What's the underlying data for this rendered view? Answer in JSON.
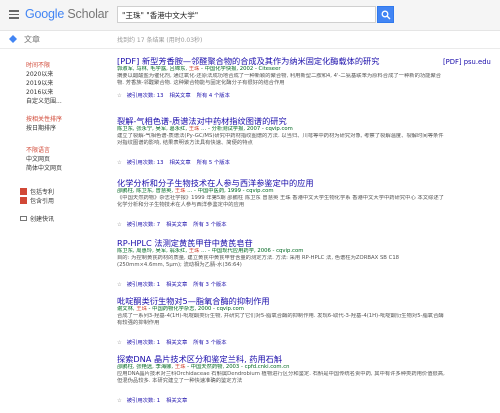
{
  "header": {
    "logo_google": "Google",
    "logo_scholar": " Scholar",
    "search_query": "\"王珠\" \"香港中文大学\""
  },
  "subbar": {
    "articles_label": "文章",
    "result_stats": "找到约 17 条结果 (用时0.03秒)"
  },
  "sidebar": {
    "time_filters": [
      "时间不限",
      "2020以来",
      "2019以来",
      "2016以来",
      "自定义范围..."
    ],
    "sort_options": [
      "按相关性排序",
      "按日期排序"
    ],
    "language_options": [
      "不限语言",
      "中文网页",
      "简体中文网页"
    ],
    "include_patents": "包括专利",
    "include_citations": "包含引用",
    "create_alert": "创建快讯"
  },
  "results": [
    {
      "tag": "[PDF]",
      "title": "新型芳香胺—邻醛聚合物的合成及其作为纳米固定化酶载体的研究",
      "meta_pre": "郭淑军, 马林, 毛学露, 吕锦东, ",
      "meta_red": "王珠",
      "meta_post": " - 中国化学快报, 2002 - Citeseer",
      "snippet": "摘要以醋酸盐为催化剂, 通过氧化-还原法成功地合成了一种新颖的聚合物, 利用新型二胺和4, 4'-二氨基联苯为原料合成了一种新的功能聚合物. 芳香族-邻醛聚合物. 这种聚合物能与固定化酶分子有很好的结合作用",
      "links": [
        "被引用次数: 13",
        "相关文章",
        "所有 4 个版本"
      ],
      "pdf_side": "[PDF] psu.edu"
    },
    {
      "tag": "",
      "title": "裂解-气相色谱-质谱法对中药材指纹图谱的研究",
      "meta_pre": "陈卫东, 张永宁, 吴军, 葛永红, ",
      "meta_red": "王珠",
      "meta_post": " … - 分析测试学报, 2007 - cqvip.com",
      "snippet": "建立了裂解-气相色谱-质谱法(Py-GC/MS)研究中药材指纹图谱的方法. 以当归、川芎等中药材为研究对象, 考察了裂解温度、裂解时间等条件对指纹图谱的影响, 结果表明该方法具有快速、简便的特点",
      "links": [
        "被引用次数: 13",
        "相关文章",
        "所有 5 个版本"
      ],
      "pdf_side": ""
    },
    {
      "tag": "",
      "title": "化学分析和分子生物技术在人参与西洋参鉴定中的应用",
      "meta_pre": "邵鹏柱, 陈卫东, 曾慧英, ",
      "meta_red": "王珠",
      "meta_post": " … - 中国中医药, 1999 - cqvip.com",
      "snippet": "《中国天然药物》杂志社学报》1999 年第5期 邵鹏柱 陈卫东 曾慧英 王珠 香港中文大学生物化学系 香港中文大学中药研究中心 本文综述了化学分析和分子生物技术在人参与西洋参鉴定中的应用",
      "links": [
        "被引用次数: 7",
        "相关文章",
        "所有 3 个版本"
      ],
      "pdf_side": ""
    },
    {
      "tag": "",
      "title": "RP-HPLC 法测定黄芪甲苷中黄芪皂苷",
      "meta_pre": "陈卫东, 周惠玲, 吴军, 翁永红, ",
      "meta_red": "王珠",
      "meta_post": " … - 中国现代应用药学, 2006 - cqvip.com",
      "snippet": "目的: 为控制黄芪药材的质量, 建立黄芪中黄芪甲苷含量的测定方法. 方法: 采用 RP-HPLC 法, 色谱柱为ZORBAX SB C18 (250mm×4.6mm, 5μm); 流动相为乙腈-水(36:64)",
      "links": [
        "被引用次数: 1",
        "相关文章",
        "所有 3 个版本"
      ],
      "pdf_side": ""
    },
    {
      "tag": "",
      "title": "吡啶酮类衍生物对5—脂氧合酶的抑制作用",
      "meta_pre": "谢文林, ",
      "meta_red": "王珠",
      "meta_post": " - 中国药物化学杂志, 2000 - cqvip.com",
      "snippet": "合成了一系列3-羟基-4(1H)-吡啶酮类衍生物, 并研究了它们对5-脂氧合酶的抑制作用. 发现6-取代-3-羟基-4(1H)-吡啶酮衍生物对5-脂氧合酶有较强的抑制作用",
      "links": [
        "被引用次数: 1",
        "相关文章",
        "所有 3 个版本"
      ],
      "pdf_side": ""
    },
    {
      "tag": "",
      "title": "探索DNA 晶片技术区分和鉴定兰科, 药用石斛",
      "meta_pre": "邵鹏柱, 张艳远, 李海娜, ",
      "meta_red": "王珠",
      "meta_post": " - 中国天然药物, 2003 - cpfd.cnki.com.cn",
      "snippet": "应用DNA晶片技术对兰科Orchidaceae 石斛属Dendrobium 植物进行区分和鉴定. 石斛是中国传统名贵中药, 其中有许多种类药用价值很高, 但混伪品较多. 本研究建立了一种快速准确的鉴定方法",
      "links": [
        "被引用次数: 1",
        "相关文章"
      ],
      "pdf_side": ""
    }
  ]
}
